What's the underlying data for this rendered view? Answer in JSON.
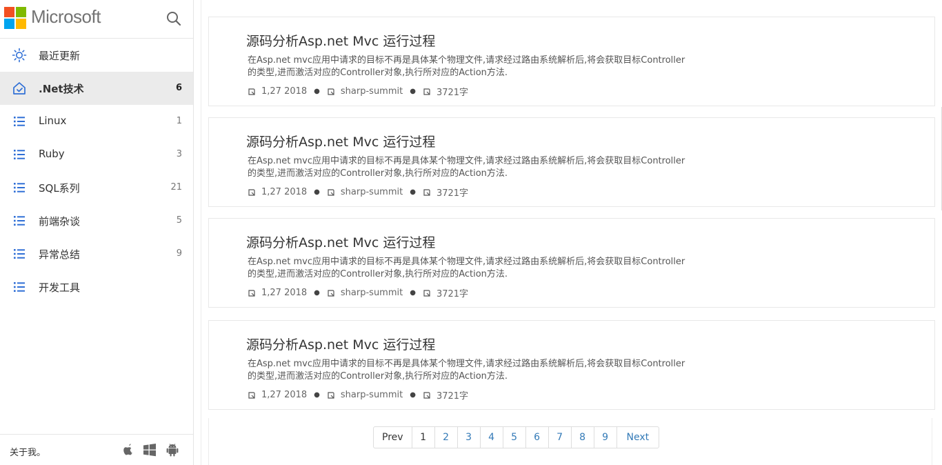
{
  "brand": {
    "name": "Microsoft",
    "logo_colors": [
      "#f25022",
      "#7fba00",
      "#00a4ef",
      "#ffb900"
    ]
  },
  "sidebar": {
    "search_icon": "search-icon",
    "items": [
      {
        "label": "最近更新",
        "count": "",
        "icon": "sun-icon",
        "active": false
      },
      {
        "label": ".Net技术",
        "count": "6",
        "icon": "home-icon",
        "active": true
      },
      {
        "label": "Linux",
        "count": "1",
        "icon": "list-icon",
        "active": false
      },
      {
        "label": "Ruby",
        "count": "3",
        "icon": "list-icon",
        "active": false
      },
      {
        "label": "SQL系列",
        "count": "21",
        "icon": "list-icon",
        "active": false
      },
      {
        "label": "前端杂谈",
        "count": "5",
        "icon": "list-icon",
        "active": false
      },
      {
        "label": "异常总结",
        "count": "9",
        "icon": "list-icon",
        "active": false
      },
      {
        "label": "开发工具",
        "count": "",
        "icon": "list-icon",
        "active": false
      }
    ],
    "footer": {
      "about": "关于我。",
      "icons": [
        "apple-icon",
        "windows-icon",
        "android-icon"
      ]
    },
    "accent_color": "#2f6fd6"
  },
  "posts": [
    {
      "title": "源码分析Asp.net Mvc 运行过程",
      "excerpt": "在Asp.net mvc应用中请求的目标不再是具体某个物理文件,请求经过路由系统解析后,将会获取目标Controller的类型,进而激活对应的Controller对象,执行所对应的Action方法.",
      "date": "1,27 2018",
      "author": "sharp-summit",
      "words": "3721字"
    },
    {
      "title": "源码分析Asp.net Mvc 运行过程",
      "excerpt": "在Asp.net mvc应用中请求的目标不再是具体某个物理文件,请求经过路由系统解析后,将会获取目标Controller的类型,进而激活对应的Controller对象,执行所对应的Action方法.",
      "date": "1,27 2018",
      "author": "sharp-summit",
      "words": "3721字"
    },
    {
      "title": "源码分析Asp.net Mvc 运行过程",
      "excerpt": "在Asp.net mvc应用中请求的目标不再是具体某个物理文件,请求经过路由系统解析后,将会获取目标Controller的类型,进而激活对应的Controller对象,执行所对应的Action方法.",
      "date": "1,27 2018",
      "author": "sharp-summit",
      "words": "3721字"
    },
    {
      "title": "源码分析Asp.net Mvc 运行过程",
      "excerpt": "在Asp.net mvc应用中请求的目标不再是具体某个物理文件,请求经过路由系统解析后,将会获取目标Controller的类型,进而激活对应的Controller对象,执行所对应的Action方法.",
      "date": "1,27 2018",
      "author": "sharp-summit",
      "words": "3721字"
    }
  ],
  "pagination": {
    "prev": "Prev",
    "pages": [
      "1",
      "2",
      "3",
      "4",
      "5",
      "6",
      "7",
      "8",
      "9"
    ],
    "current": "1",
    "next": "Next",
    "link_color": "#337ab7"
  }
}
